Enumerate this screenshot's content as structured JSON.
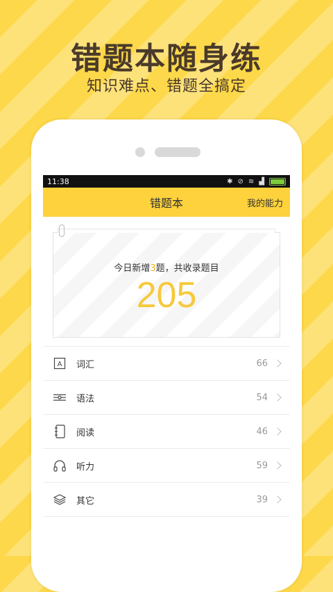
{
  "promo": {
    "title": "错题本随身练",
    "subtitle": "知识难点、错题全搞定"
  },
  "status_bar": {
    "time": "11:38"
  },
  "app_bar": {
    "title": "错题本",
    "action": "我的能力"
  },
  "summary": {
    "prefix": "今日新增",
    "new_count": "3",
    "suffix": "题，共收录题目",
    "total": "205",
    "highlight_color": "#f7c93b"
  },
  "categories": [
    {
      "label": "词汇",
      "count": "66",
      "icon": "letter-a-icon"
    },
    {
      "label": "语法",
      "count": "54",
      "icon": "sliders-icon"
    },
    {
      "label": "阅读",
      "count": "46",
      "icon": "notebook-icon"
    },
    {
      "label": "听力",
      "count": "59",
      "icon": "headphones-icon"
    },
    {
      "label": "其它",
      "count": "39",
      "icon": "layers-icon"
    }
  ],
  "colors": {
    "accent": "#fdd23c",
    "background_stripe": "#fdd84a"
  }
}
